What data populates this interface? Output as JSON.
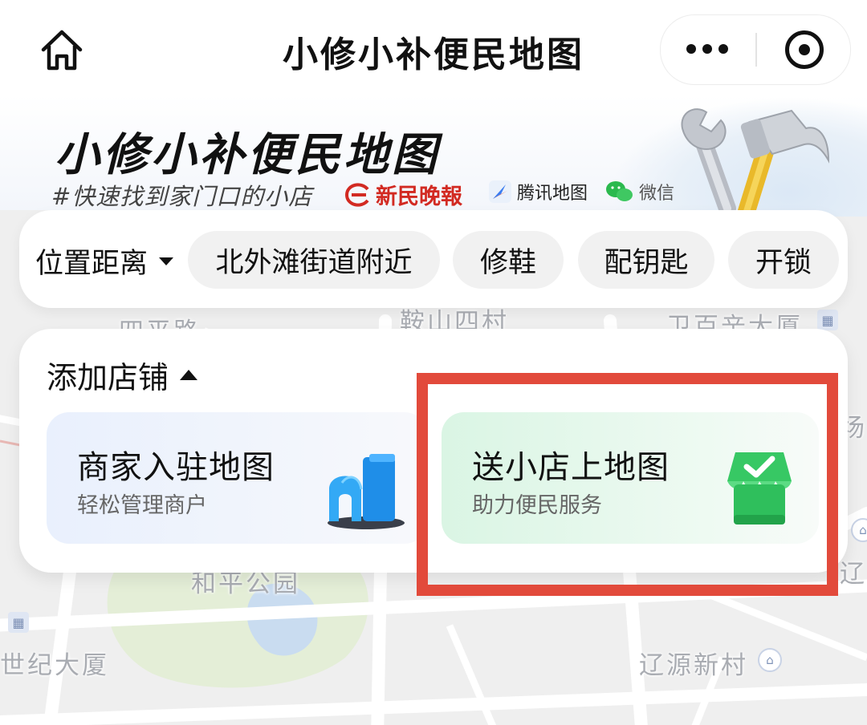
{
  "navbar": {
    "title": "小修小补便民地图",
    "home_icon": "home-icon",
    "more_icon": "more-dots-icon",
    "close_icon": "record-icon"
  },
  "hero": {
    "title": "小修小补便民地图",
    "tagline": "#快速找到家门口的小店",
    "partners": [
      {
        "name": "新民晚報",
        "icon": "xinmin-logo"
      },
      {
        "name": "腾讯地图",
        "icon": "tencent-map-logo"
      },
      {
        "name": "微信",
        "icon": "wechat-logo"
      }
    ],
    "illustration": "wrench-hammer-icon"
  },
  "filters": {
    "sort_label": "位置距离",
    "chips": [
      "北外滩街道附近",
      "修鞋",
      "配钥匙",
      "开锁"
    ]
  },
  "add_store": {
    "title": "添加店铺",
    "cards": [
      {
        "title": "商家入驻地图",
        "subtitle": "轻松管理商户",
        "icon": "building-icon"
      },
      {
        "title": "送小店上地图",
        "subtitle": "助力便民服务",
        "icon": "shop-check-icon"
      }
    ]
  },
  "map": {
    "labels": [
      "四平路",
      "鞍山四村",
      "卫百辛大厦",
      "和平公园",
      "世纪大厦",
      "辽源新村",
      "辽",
      "场"
    ]
  },
  "colors": {
    "highlight": "#e24a3b",
    "brand_red": "#d22a22",
    "green_card": "#daf5e4",
    "blue_card": "#e9f0fd"
  }
}
